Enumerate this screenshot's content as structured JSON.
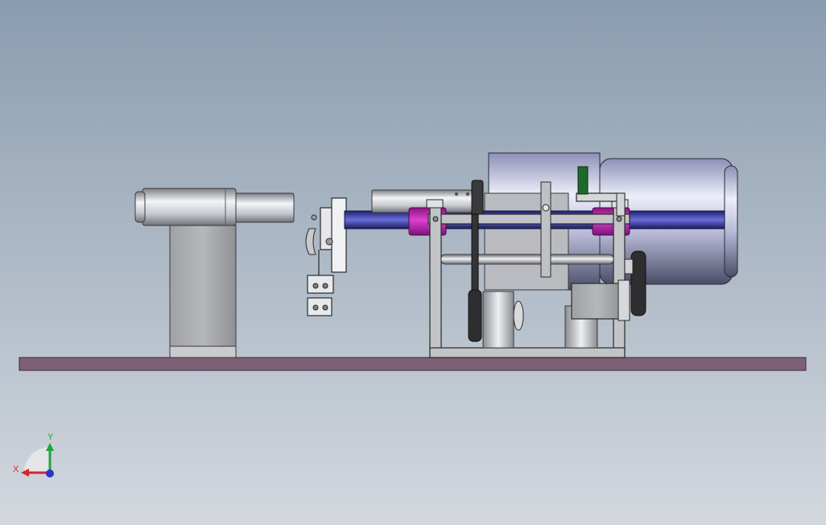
{
  "viewport": {
    "background_top": "#8a9cb0",
    "background_bottom": "#d3d8de"
  },
  "triad": {
    "x_label": "X",
    "y_label": "Y",
    "x_color": "#d8242b",
    "y_color": "#1fa33a",
    "z_color": "#2a35c4"
  },
  "colors": {
    "baseplate": "#7d5f76",
    "frame": "#b8babd",
    "bearing": "#c020b0",
    "shaft": "#3a3da0",
    "motor_body": "#c9cbe4",
    "dark_part": "#2c2c2c",
    "green_part": "#1e6a2c"
  }
}
